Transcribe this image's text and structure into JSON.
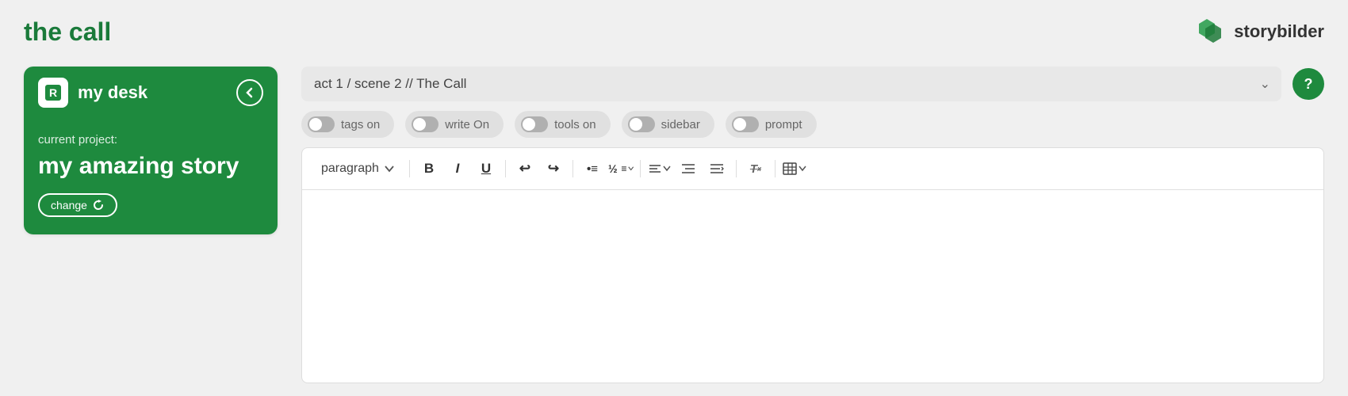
{
  "header": {
    "app_title": "the call",
    "logo_text_plain": "story",
    "logo_text_bold": "bilder"
  },
  "sidebar": {
    "desk_label": "my desk",
    "current_project_label": "current project:",
    "project_name": "my amazing story",
    "change_button": "change"
  },
  "breadcrumb": {
    "value": "act 1 / scene 2 // The Call"
  },
  "toggles": [
    {
      "id": "tags-on",
      "label": "tags on",
      "active": false
    },
    {
      "id": "write-on",
      "label": "write On",
      "active": false
    },
    {
      "id": "tools-on",
      "label": "tools on",
      "active": false
    },
    {
      "id": "sidebar",
      "label": "sidebar",
      "active": false
    },
    {
      "id": "prompt",
      "label": "prompt",
      "active": false
    }
  ],
  "toolbar": {
    "paragraph_label": "paragraph",
    "buttons": [
      "B",
      "I",
      "U",
      "↩",
      "↪",
      "•≡",
      "½≡",
      "≡",
      "Tx",
      "⊞"
    ]
  },
  "help_button": "?"
}
